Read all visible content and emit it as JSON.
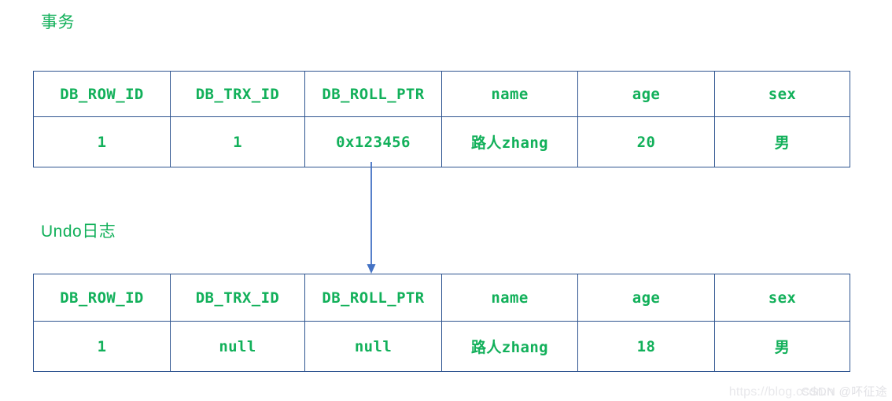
{
  "sections": {
    "transaction": {
      "caption": "事务"
    },
    "undo_log": {
      "caption": "Undo日志"
    }
  },
  "colors": {
    "text_green": "#12b05a",
    "table_border": "#2e5490",
    "arrow_blue": "#4472c4",
    "background": "#ffffff",
    "watermark": "#e9e9ec"
  },
  "tables": {
    "transaction": {
      "columns": [
        "DB_ROW_ID",
        "DB_TRX_ID",
        "DB_ROLL_PTR",
        "name",
        "age",
        "sex"
      ],
      "rows": [
        [
          "1",
          "1",
          "0x123456",
          "路人zhang",
          "20",
          "男"
        ]
      ]
    },
    "undo_log": {
      "columns": [
        "DB_ROW_ID",
        "DB_TRX_ID",
        "DB_ROLL_PTR",
        "name",
        "age",
        "sex"
      ],
      "rows": [
        [
          "1",
          "null",
          "null",
          "路人zhang",
          "18",
          "男"
        ]
      ]
    }
  },
  "connector": {
    "name": "roll-pointer-arrow",
    "direction": "down"
  },
  "watermark": {
    "url": "https://blog.csdn.n",
    "brand": "CSDN @吥征途"
  }
}
